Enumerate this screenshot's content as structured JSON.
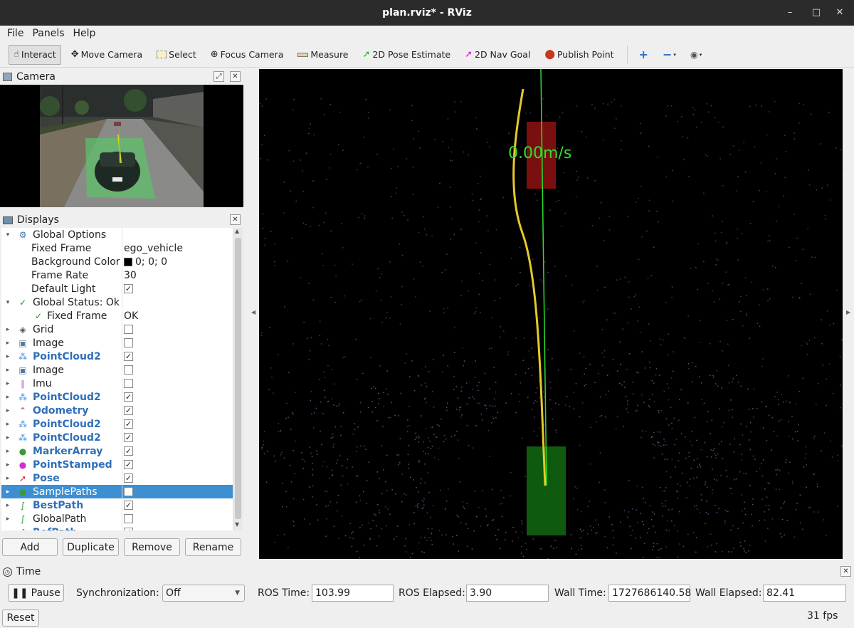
{
  "window": {
    "title": "plan.rviz* - RViz"
  },
  "menu": [
    "File",
    "Panels",
    "Help"
  ],
  "toolbar": {
    "interact": "Interact",
    "move_camera": "Move Camera",
    "select": "Select",
    "focus_camera": "Focus Camera",
    "measure": "Measure",
    "pose_estimate": "2D Pose Estimate",
    "nav_goal": "2D Nav Goal",
    "publish_point": "Publish Point"
  },
  "camera_panel": {
    "title": "Camera"
  },
  "displays_panel": {
    "title": "Displays",
    "rows": [
      {
        "name": "Global Options",
        "value": "",
        "check": null,
        "style": "plain",
        "level": 0,
        "icon": "gear-icon",
        "expanded": true
      },
      {
        "name": "Fixed Frame",
        "value": "ego_vehicle",
        "check": null,
        "style": "plain",
        "level": 1,
        "icon": ""
      },
      {
        "name": "Background Color",
        "value": "0; 0; 0",
        "check": null,
        "style": "plain",
        "level": 1,
        "icon": "",
        "swatch": "#000000"
      },
      {
        "name": "Frame Rate",
        "value": "30",
        "check": null,
        "style": "plain",
        "level": 1,
        "icon": ""
      },
      {
        "name": "Default Light",
        "value": "",
        "check": true,
        "style": "plain",
        "level": 1,
        "icon": ""
      },
      {
        "name": "Global Status: Ok",
        "value": "",
        "check": null,
        "style": "plain",
        "level": 0,
        "icon": "check-icon",
        "expanded": true
      },
      {
        "name": "Fixed Frame",
        "value": "OK",
        "check": null,
        "style": "plain",
        "level": 1,
        "icon": "check-icon"
      },
      {
        "name": "Grid",
        "value": "",
        "check": false,
        "style": "plain",
        "level": 0,
        "icon": "grid-icon"
      },
      {
        "name": "Image",
        "value": "",
        "check": false,
        "style": "plain",
        "level": 0,
        "icon": "image-icon"
      },
      {
        "name": "PointCloud2",
        "value": "",
        "check": true,
        "style": "blue",
        "level": 0,
        "icon": "pointcloud-icon"
      },
      {
        "name": "Image",
        "value": "",
        "check": false,
        "style": "plain",
        "level": 0,
        "icon": "image-icon"
      },
      {
        "name": "Imu",
        "value": "",
        "check": false,
        "style": "plain",
        "level": 0,
        "icon": "imu-icon"
      },
      {
        "name": "PointCloud2",
        "value": "",
        "check": true,
        "style": "blue",
        "level": 0,
        "icon": "pointcloud-icon"
      },
      {
        "name": "Odometry",
        "value": "",
        "check": true,
        "style": "blue",
        "level": 0,
        "icon": "odometry-icon"
      },
      {
        "name": "PointCloud2",
        "value": "",
        "check": true,
        "style": "blue",
        "level": 0,
        "icon": "pointcloud-icon"
      },
      {
        "name": "PointCloud2",
        "value": "",
        "check": true,
        "style": "blue",
        "level": 0,
        "icon": "pointcloud-icon"
      },
      {
        "name": "MarkerArray",
        "value": "",
        "check": true,
        "style": "blue",
        "level": 0,
        "icon": "marker-icon"
      },
      {
        "name": "PointStamped",
        "value": "",
        "check": true,
        "style": "blue",
        "level": 0,
        "icon": "point-icon"
      },
      {
        "name": "Pose",
        "value": "",
        "check": true,
        "style": "blue",
        "level": 0,
        "icon": "pose-icon"
      },
      {
        "name": "SamplePaths",
        "value": "",
        "check": false,
        "style": "plain",
        "level": 0,
        "icon": "marker-icon",
        "selected": true
      },
      {
        "name": "BestPath",
        "value": "",
        "check": true,
        "style": "blue",
        "level": 0,
        "icon": "path-icon"
      },
      {
        "name": "GlobalPath",
        "value": "",
        "check": false,
        "style": "plain",
        "level": 0,
        "icon": "path-icon"
      },
      {
        "name": "RefPath",
        "value": "",
        "check": true,
        "style": "blue",
        "level": 0,
        "icon": "path-icon"
      }
    ],
    "buttons": {
      "add": "Add",
      "duplicate": "Duplicate",
      "remove": "Remove",
      "rename": "Rename"
    }
  },
  "viewport": {
    "speed_label": "0.00m/s"
  },
  "time_panel": {
    "title": "Time",
    "pause": "Pause",
    "sync_label": "Synchronization:",
    "sync_value": "Off",
    "ros_time_label": "ROS Time:",
    "ros_time": "103.99",
    "ros_elapsed_label": "ROS Elapsed:",
    "ros_elapsed": "3.90",
    "wall_time_label": "Wall Time:",
    "wall_time": "1727686140.58",
    "wall_elapsed_label": "Wall Elapsed:",
    "wall_elapsed": "82.41"
  },
  "status": {
    "reset": "Reset",
    "fps": "31 fps"
  }
}
